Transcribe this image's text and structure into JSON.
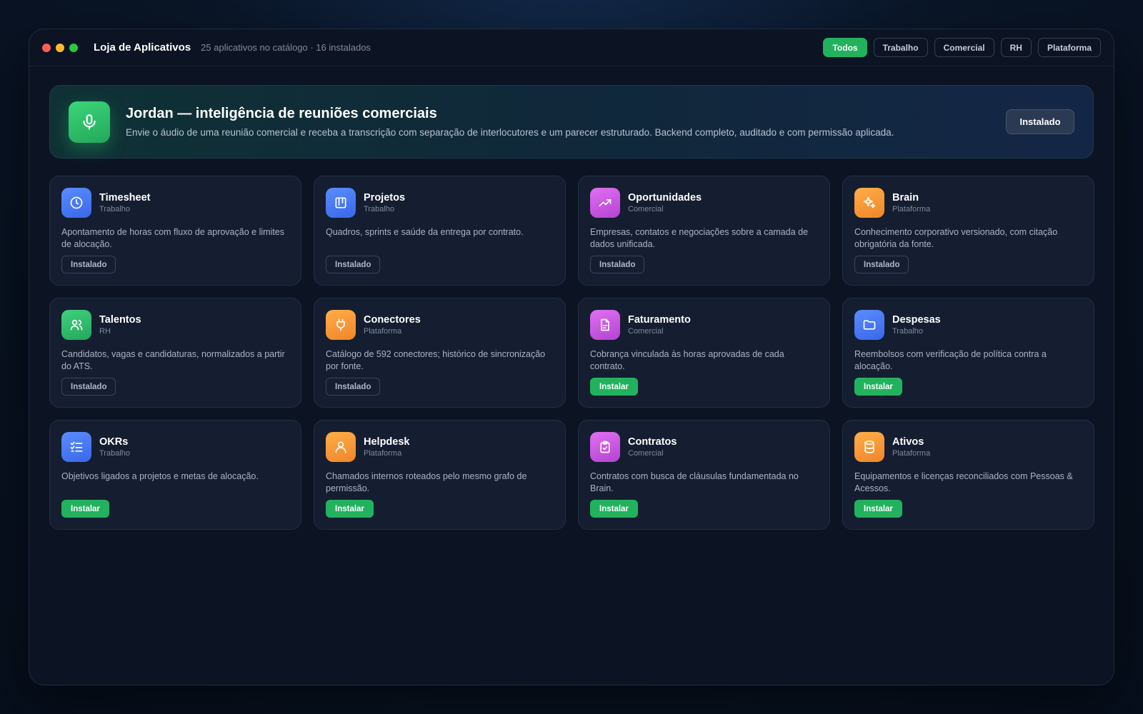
{
  "window": {
    "title": "Loja de Aplicativos",
    "subtitle": "25 aplicativos no catálogo · 16 instalados"
  },
  "filters": [
    {
      "label": "Todos",
      "active": true
    },
    {
      "label": "Trabalho",
      "active": false
    },
    {
      "label": "Comercial",
      "active": false
    },
    {
      "label": "RH",
      "active": false
    },
    {
      "label": "Plataforma",
      "active": false
    }
  ],
  "featured": {
    "icon": "microphone-icon",
    "title": "Jordan — inteligência de reuniões comerciais",
    "description": "Envie o áudio de uma reunião comercial e receba a transcrição com separação de interlocutores e um parecer estruturado. Backend completo, auditado e com permissão aplicada.",
    "button_label": "Instalado"
  },
  "apps": [
    {
      "name": "Timesheet",
      "category": "Trabalho",
      "description": "Apontamento de horas com fluxo de aprovação e limites de alocação.",
      "button": "Instalado",
      "installed": true,
      "icon": "clock-icon",
      "color": "blue"
    },
    {
      "name": "Projetos",
      "category": "Trabalho",
      "description": "Quadros, sprints e saúde da entrega por contrato.",
      "button": "Instalado",
      "installed": true,
      "icon": "kanban-icon",
      "color": "blue"
    },
    {
      "name": "Oportunidades",
      "category": "Comercial",
      "description": "Empresas, contatos e negociações sobre a camada de dados unificada.",
      "button": "Instalado",
      "installed": true,
      "icon": "trending-up-icon",
      "color": "pink"
    },
    {
      "name": "Brain",
      "category": "Plataforma",
      "description": "Conhecimento corporativo versionado, com citação obrigatória da fonte.",
      "button": "Instalado",
      "installed": true,
      "icon": "sparkles-icon",
      "color": "orange"
    },
    {
      "name": "Talentos",
      "category": "RH",
      "description": "Candidatos, vagas e candidaturas, normalizados a partir do ATS.",
      "button": "Instalado",
      "installed": true,
      "icon": "users-icon",
      "color": "green"
    },
    {
      "name": "Conectores",
      "category": "Plataforma",
      "description": "Catálogo de 592 conectores; histórico de sincronização por fonte.",
      "button": "Instalado",
      "installed": true,
      "icon": "plug-icon",
      "color": "orange"
    },
    {
      "name": "Faturamento",
      "category": "Comercial",
      "description": "Cobrança vinculada às horas aprovadas de cada contrato.",
      "button": "Instalar",
      "installed": false,
      "icon": "file-text-icon",
      "color": "pink"
    },
    {
      "name": "Despesas",
      "category": "Trabalho",
      "description": "Reembolsos com verificação de política contra a alocação.",
      "button": "Instalar",
      "installed": false,
      "icon": "folder-icon",
      "color": "blue"
    },
    {
      "name": "OKRs",
      "category": "Trabalho",
      "description": "Objetivos ligados a projetos e metas de alocação.",
      "button": "Instalar",
      "installed": false,
      "icon": "checklist-icon",
      "color": "blue"
    },
    {
      "name": "Helpdesk",
      "category": "Plataforma",
      "description": "Chamados internos roteados pelo mesmo grafo de permissão.",
      "button": "Instalar",
      "installed": false,
      "icon": "user-icon",
      "color": "orange"
    },
    {
      "name": "Contratos",
      "category": "Comercial",
      "description": "Contratos com busca de cláusulas fundamentada no Brain.",
      "button": "Instalar",
      "installed": false,
      "icon": "clipboard-check-icon",
      "color": "pink"
    },
    {
      "name": "Ativos",
      "category": "Plataforma",
      "description": "Equipamentos e licenças reconciliados com Pessoas & Acessos.",
      "button": "Instalar",
      "installed": false,
      "icon": "database-icon",
      "color": "orange"
    }
  ]
}
